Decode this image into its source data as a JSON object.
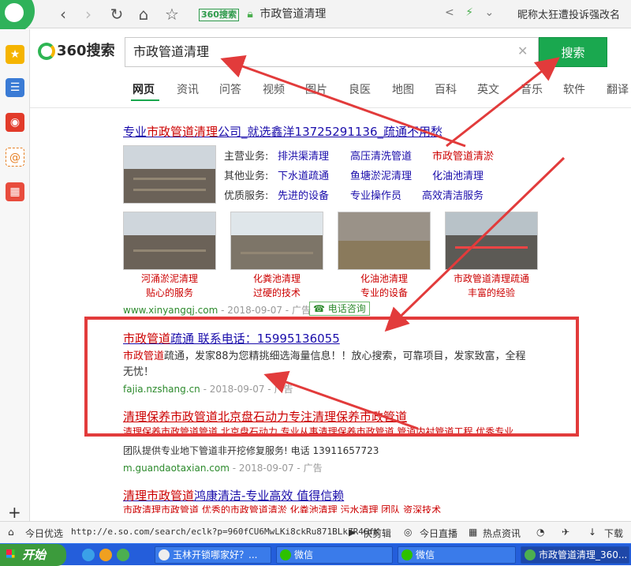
{
  "browser": {
    "address_badge": "360搜索",
    "address_text": "市政管道清理",
    "user_name": "昵称太狂遭投诉强改名"
  },
  "search": {
    "logo_text": "360搜索",
    "query": "市政管道清理",
    "button_label": "搜索"
  },
  "tabs": [
    "网页",
    "资讯",
    "问答",
    "视频",
    "图片",
    "良医",
    "地图",
    "百科",
    "英文",
    "音乐",
    "软件",
    "翻译"
  ],
  "ad1": {
    "title_a": "专业",
    "title_hl": "市政管道清理",
    "title_b": "公司_就选鑫洋13725291136_疏通不用愁",
    "rows": [
      {
        "label": "主营业务:",
        "items": [
          "排洪渠清理",
          "高压清洗管道",
          "市政管道清淤"
        ]
      },
      {
        "label": "其他业务:",
        "items": [
          "下水道疏通",
          "鱼塘淤泥清理",
          "化油池清理"
        ]
      },
      {
        "label": "优质服务:",
        "items": [
          "先进的设备",
          "专业操作员",
          "高效清洁服务"
        ]
      }
    ],
    "captions": [
      [
        "河涌淤泥清理",
        "贴心的服务"
      ],
      [
        "化粪池清理",
        "过硬的技术"
      ],
      [
        "化油池清理",
        "专业的设备"
      ],
      [
        "市政管道清理疏通",
        "丰富的经验"
      ]
    ],
    "url": "www.xinyangqj.com",
    "date": " - 2018-09-07 - 广告",
    "tel_label": "电话咨询"
  },
  "ad2": {
    "title_hl": "市政管道",
    "title_b": "疏通 联系电话：15995136055",
    "desc_hl": "市政管道",
    "desc_b": "疏通，发家88为您精挑细选海量信息！！放心搜索，可靠项目，发家致富，全程无忧！",
    "url": "fajia.nzshang.cn",
    "date": " - 2018-09-07 - 广告"
  },
  "ad3": {
    "title": "清理保养市政管道北京盘石动力专注清理保养市政管道",
    "desc_line1": "清理保养市政管道管道 北京盘石动力 专业从事清理保养市政管道 管道内衬管道工程 优秀专业",
    "desc_line2": "团队提供专业地下管道非开挖修复服务! 电话 13911657723",
    "url": "m.guandaotaxian.com",
    "date": " - 2018-09-07 - 广告"
  },
  "ad4": {
    "title_hl": "清理市政管道",
    "title_b": "鸿康清洁-专业高效 值得信赖",
    "desc": "市政清理市政管道 优秀的市政管道清淤 化粪池清理 污水清理 团队 资深技术"
  },
  "statusbar": {
    "today": "今日优选",
    "url": "http://e.so.com/search/eclk?p=960fCU6MwLKi8ckRu871BLkZR4GfK",
    "items": [
      "快剪辑",
      "今日直播",
      "热点资讯",
      "下载"
    ]
  },
  "taskbar": {
    "start": "开始",
    "tasks": [
      "玉林开锁哪家好？...",
      "微信",
      "微信",
      "市政管道清理_360..."
    ]
  }
}
